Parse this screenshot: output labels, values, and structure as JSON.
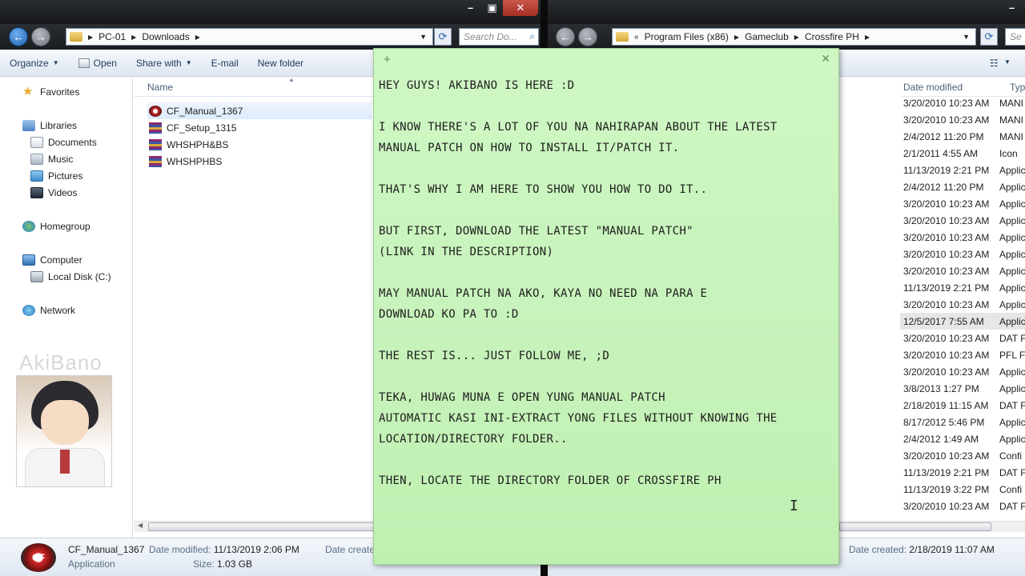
{
  "left_window": {
    "breadcrumb": [
      "PC-01",
      "Downloads"
    ],
    "search_placeholder": "Search Do...",
    "toolbar": [
      "Organize",
      "Open",
      "Share with",
      "E-mail",
      "New folder"
    ],
    "nav": {
      "favorites": "Favorites",
      "libraries": "Libraries",
      "documents": "Documents",
      "music": "Music",
      "pictures": "Pictures",
      "videos": "Videos",
      "homegroup": "Homegroup",
      "computer": "Computer",
      "local_disk": "Local Disk (C:)",
      "network": "Network"
    },
    "column_name": "Name",
    "files": [
      "CF_Manual_1367",
      "CF_Setup_1315",
      "WHSHPH&BS",
      "WHSHPHBS"
    ],
    "watermark": "AkiBano",
    "details": {
      "name": "CF_Manual_1367",
      "type": "Application",
      "modified_label": "Date modified:",
      "modified_value": "11/13/2019 2:06 PM",
      "size_label": "Size:",
      "size_value": "1.03 GB",
      "created_label": "Date create"
    }
  },
  "right_window": {
    "breadcrumb": [
      "Program Files (x86)",
      "Gameclub",
      "Crossfire PH"
    ],
    "search_placeholder": "Se",
    "columns": {
      "date": "Date modified",
      "type": "Type"
    },
    "rows": [
      {
        "date": "3/20/2010 10:23 AM",
        "type": "MANI"
      },
      {
        "date": "3/20/2010 10:23 AM",
        "type": "MANI"
      },
      {
        "date": "2/4/2012 11:20 PM",
        "type": "MANI"
      },
      {
        "date": "2/1/2011 4:55 AM",
        "type": "Icon"
      },
      {
        "date": "11/13/2019 2:21 PM",
        "type": "Applic"
      },
      {
        "date": "2/4/2012 11:20 PM",
        "type": "Applic"
      },
      {
        "date": "3/20/2010 10:23 AM",
        "type": "Applic"
      },
      {
        "date": "3/20/2010 10:23 AM",
        "type": "Applic"
      },
      {
        "date": "3/20/2010 10:23 AM",
        "type": "Applic"
      },
      {
        "date": "3/20/2010 10:23 AM",
        "type": "Applic"
      },
      {
        "date": "3/20/2010 10:23 AM",
        "type": "Applic"
      },
      {
        "date": "11/13/2019 2:21 PM",
        "type": "Applic"
      },
      {
        "date": "3/20/2010 10:23 AM",
        "type": "Applic"
      },
      {
        "date": "12/5/2017 7:55 AM",
        "type": "Applic"
      },
      {
        "date": "3/20/2010 10:23 AM",
        "type": "DAT F"
      },
      {
        "date": "3/20/2010 10:23 AM",
        "type": "PFL Fil"
      },
      {
        "date": "3/20/2010 10:23 AM",
        "type": "Applic"
      },
      {
        "date": "3/8/2013 1:27 PM",
        "type": "Applic"
      },
      {
        "date": "2/18/2019 11:15 AM",
        "type": "DAT F"
      },
      {
        "date": "8/17/2012 5:46 PM",
        "type": "Applic"
      },
      {
        "date": "2/4/2012 1:49 AM",
        "type": "Applic"
      },
      {
        "date": "3/20/2010 10:23 AM",
        "type": "Confi"
      },
      {
        "date": "11/13/2019 2:21 PM",
        "type": "DAT F"
      },
      {
        "date": "11/13/2019 3:22 PM",
        "type": "Confi"
      },
      {
        "date": "3/20/2010 10:23 AM",
        "type": "DAT F"
      }
    ],
    "details": {
      "created_label": "Date created:",
      "created_value": "2/18/2019 11:07 AM"
    }
  },
  "sticky_note": {
    "lines": [
      "HEY GUYS! AKIBANO IS HERE :D",
      "",
      "I KNOW THERE'S A LOT OF YOU NA NAHIRAPAN ABOUT THE LATEST",
      "MANUAL PATCH ON HOW TO INSTALL IT/PATCH IT.",
      "",
      "THAT'S WHY I AM HERE TO SHOW YOU HOW TO DO IT..",
      "",
      "BUT FIRST, DOWNLOAD THE LATEST \"MANUAL PATCH\"",
      "(LINK IN THE DESCRIPTION)",
      "",
      "MAY MANUAL PATCH NA AKO, KAYA NO NEED NA PARA E",
      "DOWNLOAD KO PA TO :D",
      "",
      "THE REST IS... JUST FOLLOW ME, ;D",
      "",
      "TEKA, HUWAG MUNA E OPEN YUNG MANUAL PATCH",
      "AUTOMATIC KASI INI-EXTRACT YONG FILES WITHOUT KNOWING THE",
      "LOCATION/DIRECTORY FOLDER..",
      "",
      "THEN, LOCATE THE DIRECTORY FOLDER OF CROSSFIRE PH"
    ]
  }
}
